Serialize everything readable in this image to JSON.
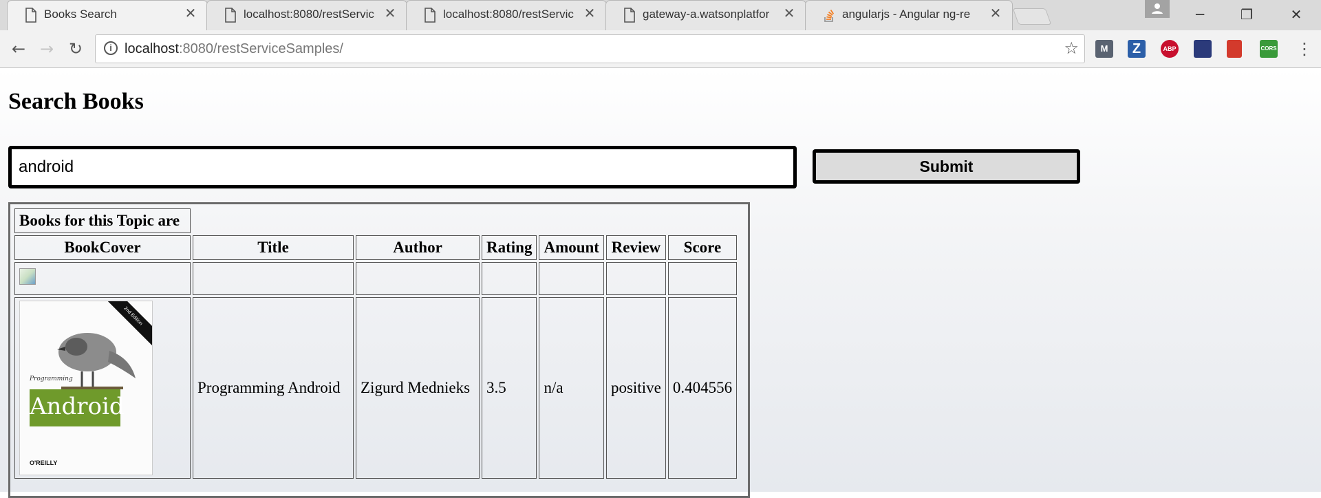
{
  "browser": {
    "tabs": [
      {
        "title": "Books Search",
        "active": true
      },
      {
        "title": "localhost:8080/restServic",
        "active": false
      },
      {
        "title": "localhost:8080/restServic",
        "active": false
      },
      {
        "title": "gateway-a.watsonplatfor",
        "active": false
      },
      {
        "title": "angularjs - Angular ng-re",
        "active": false
      }
    ],
    "address": {
      "host": "localhost",
      "rest": ":8080/restServiceSamples/"
    },
    "extensions": [
      {
        "name": "M",
        "color": "#5a6371"
      },
      {
        "name": "Z",
        "color": "#2c5fa8"
      },
      {
        "name": "ABP",
        "color": "#c8102e"
      },
      {
        "name": "",
        "color": "#2b3a7a"
      },
      {
        "name": "",
        "color": "#d33a2c"
      },
      {
        "name": "CORS",
        "color": "#3a9a3a"
      }
    ]
  },
  "page": {
    "heading": "Search Books",
    "search": {
      "value": "android"
    },
    "submit_label": "Submit",
    "table": {
      "caption": "Books for this Topic are",
      "headers": [
        "BookCover",
        "Title",
        "Author",
        "Rating",
        "Amount",
        "Review",
        "Score"
      ],
      "rows": [
        {
          "title": "",
          "author": "",
          "rating": "",
          "amount": "",
          "review": "",
          "score": ""
        },
        {
          "title": "Programming Android",
          "author": "Zigurd Mednieks",
          "rating": "3.5",
          "amount": "n/a",
          "review": "positive",
          "score": "0.404556"
        }
      ],
      "cover": {
        "series": "Programming",
        "title": "Android",
        "publisher": "O'REILLY",
        "edition": "2nd Edition"
      }
    }
  }
}
